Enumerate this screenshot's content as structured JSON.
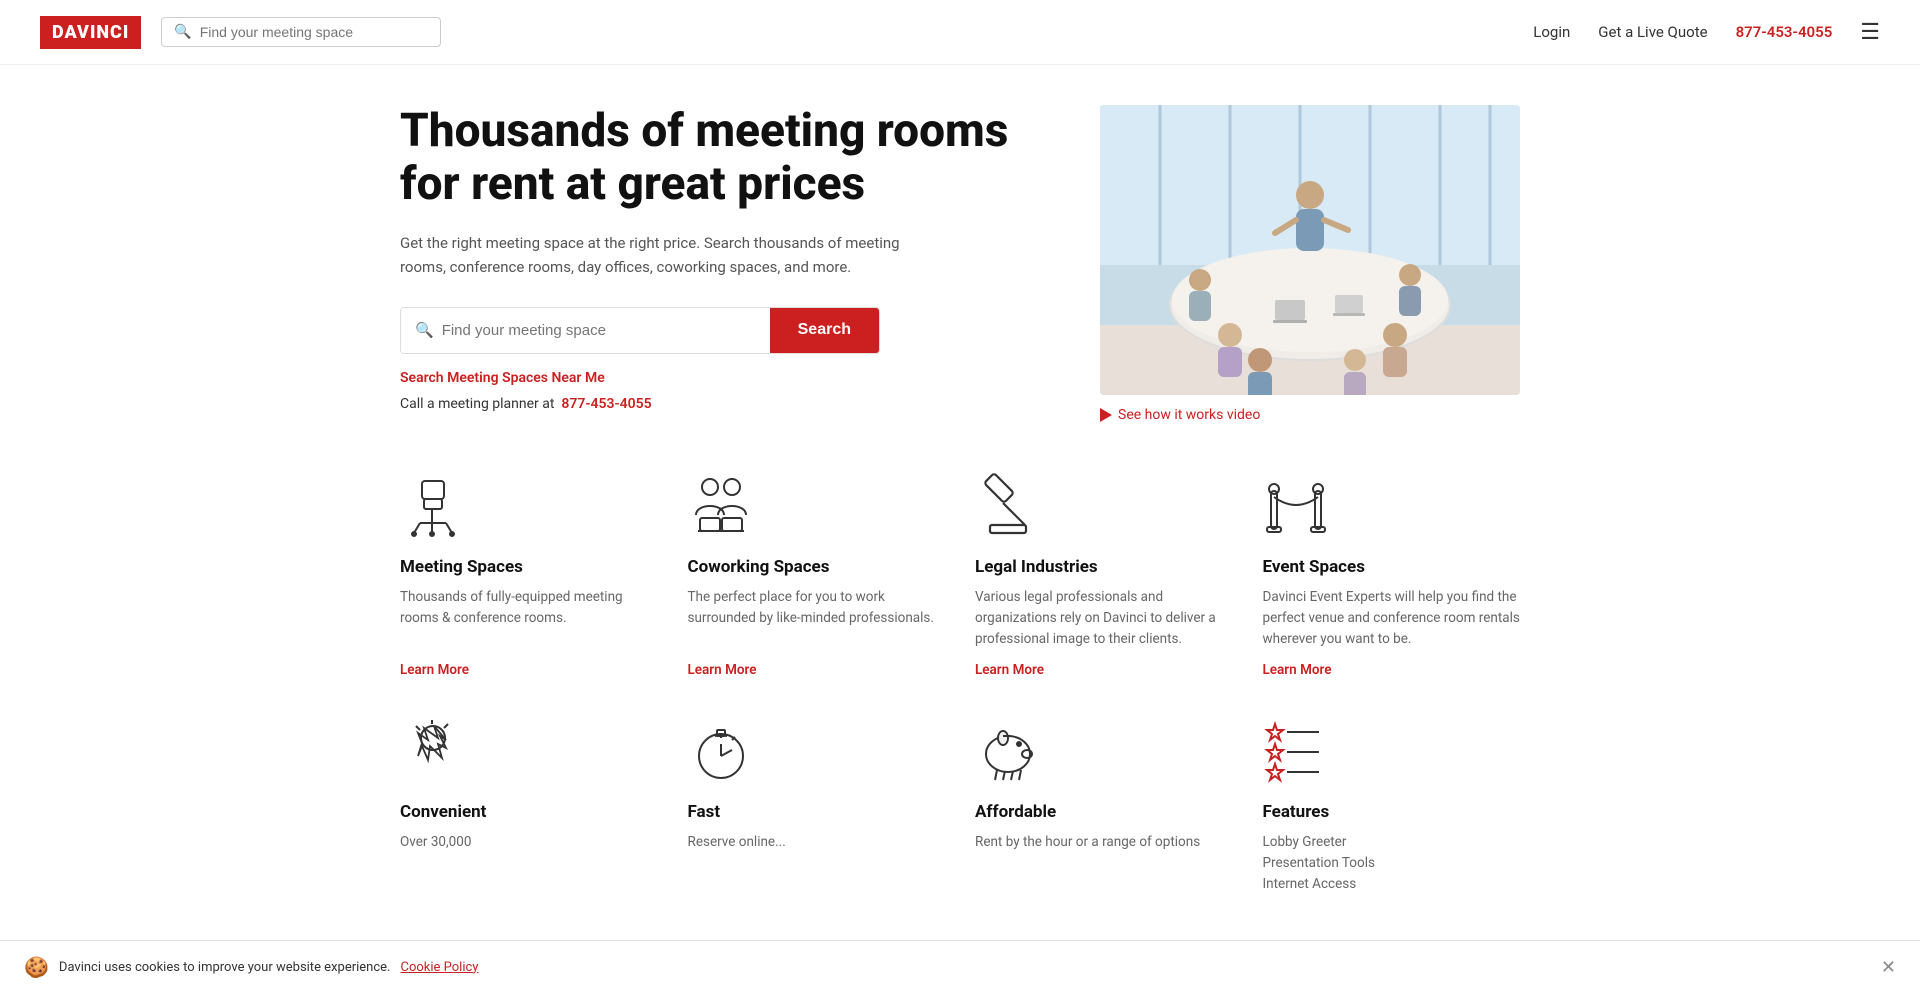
{
  "header": {
    "logo_text": "DAVINCI",
    "search_placeholder": "Find your meeting space",
    "nav": {
      "login": "Login",
      "live_quote": "Get a Live Quote",
      "phone": "877-453-4055"
    }
  },
  "hero": {
    "title": "Thousands of meeting rooms for rent at great prices",
    "description": "Get the right meeting space at the right price. Search thousands of meeting rooms, conference rooms, day offices, coworking spaces, and more.",
    "search_placeholder": "Find your meeting space",
    "search_button": "Search",
    "near_me_link": "Search Meeting Spaces Near Me",
    "call_text": "Call a meeting planner at",
    "call_phone": "877-453-4055",
    "video_link": "See how it works video"
  },
  "features": [
    {
      "id": "meeting-spaces",
      "title": "Meeting Spaces",
      "description": "Thousands of fully-equipped meeting rooms & conference rooms.",
      "link": "Learn More",
      "icon": "chair"
    },
    {
      "id": "coworking-spaces",
      "title": "Coworking Spaces",
      "description": "The perfect place for you to work surrounded by like-minded professionals.",
      "link": "Learn More",
      "icon": "coworking"
    },
    {
      "id": "legal-industries",
      "title": "Legal Industries",
      "description": "Various legal professionals and organizations rely on Davinci to deliver a professional image to their clients.",
      "link": "Learn More",
      "icon": "gavel"
    },
    {
      "id": "event-spaces",
      "title": "Event Spaces",
      "description": "Davinci Event Experts will help you find the perfect venue and conference room rentals wherever you want to be.",
      "link": "Learn More",
      "icon": "event"
    }
  ],
  "features2": [
    {
      "id": "convenient",
      "title": "Convenient",
      "description": "Over 30,000",
      "icon": "handshake"
    },
    {
      "id": "fast",
      "title": "Fast",
      "description": "Reserve online...",
      "icon": "stopwatch"
    },
    {
      "id": "affordable",
      "title": "Affordable",
      "description": "Rent by the hour or a range of options",
      "icon": "piggy"
    },
    {
      "id": "features",
      "title": "Features",
      "description": "Lobby Greeter\nPresentation Tools\nInternet Access",
      "icon": "stars-list"
    }
  ],
  "cookie": {
    "message": "Davinci uses cookies to improve your website experience.",
    "link_text": "Cookie Policy"
  },
  "colors": {
    "brand_red": "#cc1f1f",
    "text_dark": "#111111",
    "text_muted": "#666666"
  }
}
